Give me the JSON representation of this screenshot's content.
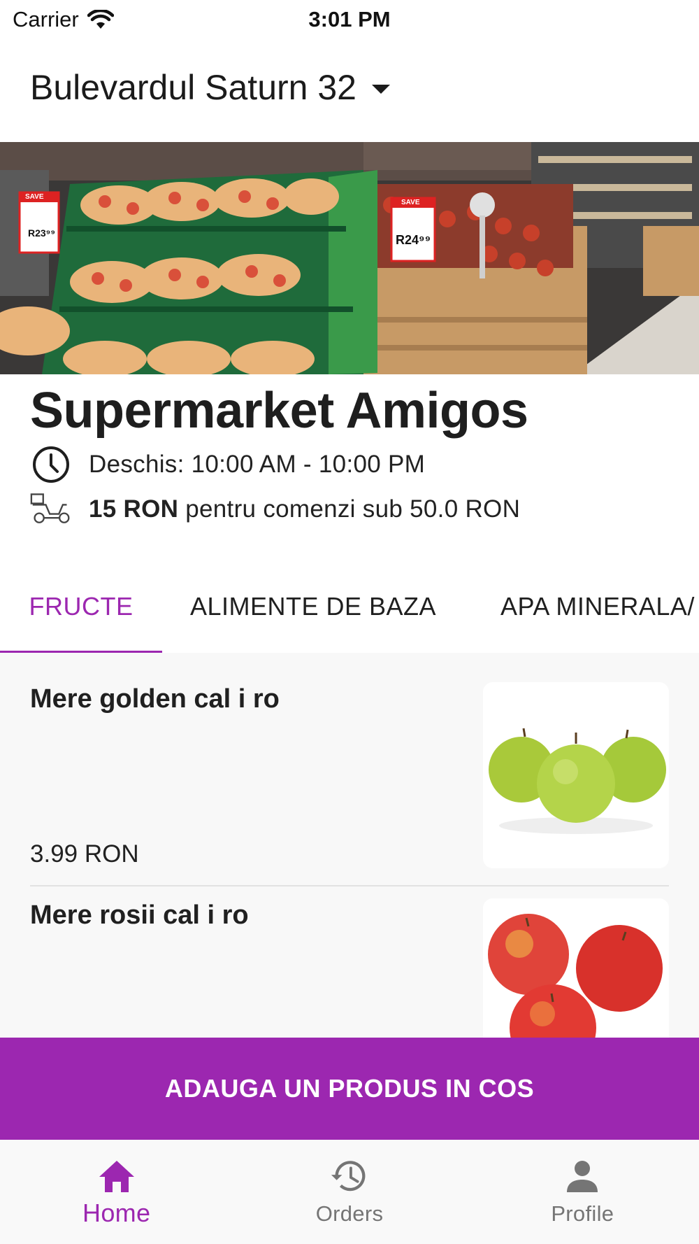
{
  "status_bar": {
    "carrier": "Carrier",
    "time": "3:01 PM"
  },
  "address": {
    "label": "Bulevardul Saturn 32"
  },
  "store": {
    "name": "Supermarket Amigos",
    "hours": "Deschis: 10:00 AM - 10:00 PM",
    "delivery_fee": "15 RON",
    "delivery_note": "pentru comenzi sub 50.0 RON",
    "banner_price_tags": [
      "R23⁹⁹",
      "R24⁹⁹"
    ],
    "banner_tag_word": "SAVE"
  },
  "tabs": [
    {
      "label": "FRUCTE",
      "active": true
    },
    {
      "label": "ALIMENTE DE BAZA",
      "active": false
    },
    {
      "label": "APA MINERALA/",
      "active": false
    }
  ],
  "products": [
    {
      "name": "Mere golden cal i ro",
      "price": "3.99 RON",
      "image": "green-apples"
    },
    {
      "name": "Mere rosii cal i ro",
      "price": "",
      "image": "red-apples"
    }
  ],
  "cart_button": {
    "label": "ADAUGA UN PRODUS IN COS"
  },
  "bottom_nav": [
    {
      "label": "Home",
      "icon": "home-icon",
      "active": true
    },
    {
      "label": "Orders",
      "icon": "history-icon",
      "active": false
    },
    {
      "label": "Profile",
      "icon": "person-icon",
      "active": false
    }
  ],
  "colors": {
    "accent": "#9c27b0",
    "inactive": "#757575",
    "list_bg": "#f8f8f8"
  }
}
